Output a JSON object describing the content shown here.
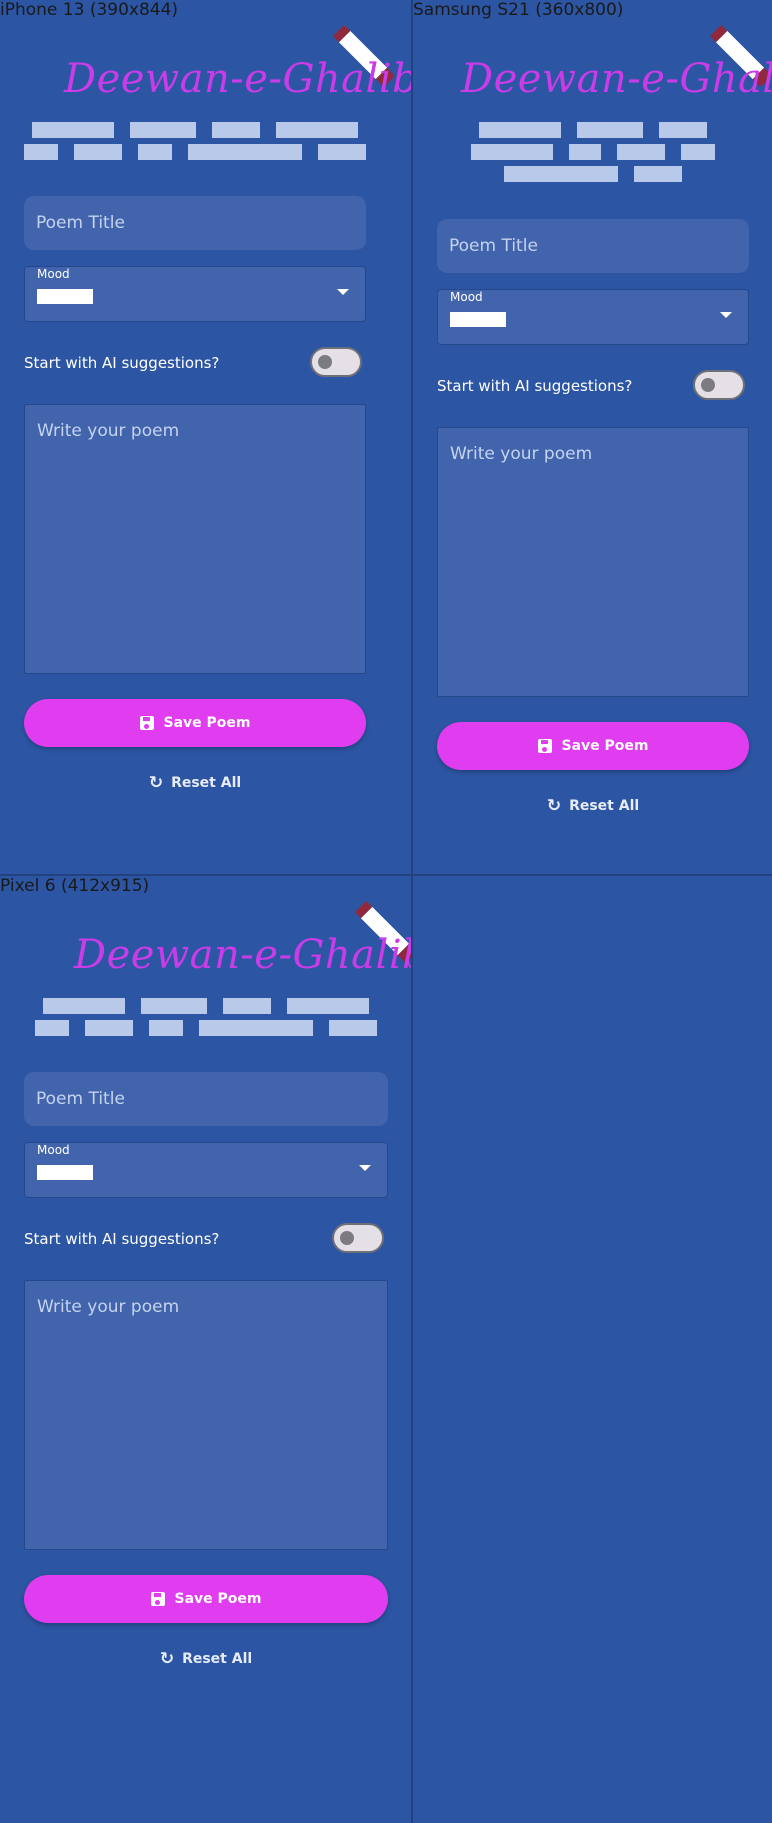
{
  "app": {
    "title": "Deewan-e-Ghalib"
  },
  "devices": [
    {
      "label": "iPhone 13 (390x844)"
    },
    {
      "label": "Samsung S21 (360x800)"
    },
    {
      "label": "Pixel 6 (412x915)"
    }
  ],
  "form": {
    "title_placeholder": "Poem Title",
    "mood_label": "Mood",
    "ai_toggle_label": "Start with AI suggestions?",
    "ai_toggle_on": false,
    "poem_placeholder": "Write your poem"
  },
  "actions": {
    "save_label": "Save Poem",
    "reset_label": "Reset All"
  },
  "icons": {
    "save": "floppy-disk-icon",
    "reset": "refresh-icon",
    "brand": "pen-icon"
  },
  "colors": {
    "background": "#2c55a3",
    "title": "#c93ce8",
    "save_button": "#e03cf0",
    "input_fill": "#4164ac"
  }
}
